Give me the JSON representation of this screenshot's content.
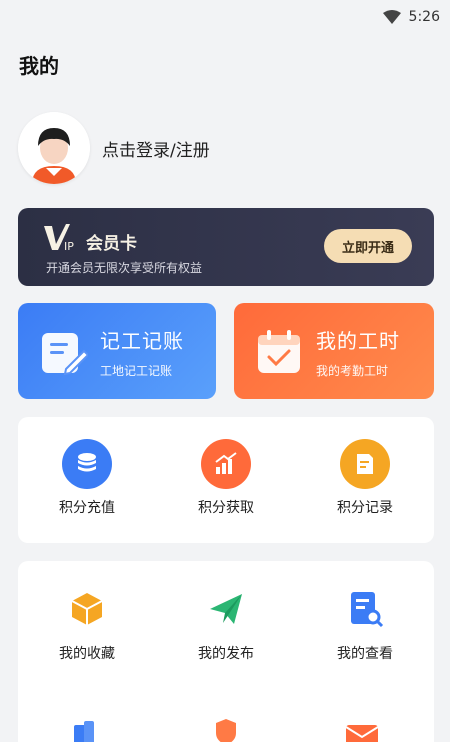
{
  "status": {
    "time": "5:26"
  },
  "header": {
    "title": "我的"
  },
  "profile": {
    "login_text": "点击登录/注册"
  },
  "vip": {
    "title": "会员卡",
    "subtitle": "开通会员无限次享受所有权益",
    "button": "立即开通"
  },
  "cards": [
    {
      "title": "记工记账",
      "subtitle": "工地记工记账",
      "icon": "ledger-icon"
    },
    {
      "title": "我的工时",
      "subtitle": "我的考勤工时",
      "icon": "calendar-check-icon"
    }
  ],
  "points": {
    "items": [
      {
        "label": "积分充值",
        "icon": "coins-icon"
      },
      {
        "label": "积分获取",
        "icon": "chart-up-icon"
      },
      {
        "label": "积分记录",
        "icon": "document-edit-icon"
      }
    ]
  },
  "mine": {
    "items": [
      {
        "label": "我的收藏",
        "icon": "box-icon"
      },
      {
        "label": "我的发布",
        "icon": "paper-plane-icon"
      },
      {
        "label": "我的查看",
        "icon": "doc-search-icon"
      }
    ]
  },
  "colors": {
    "blue": "#3b7cf5",
    "orange": "#ff6a3a",
    "vip_bg": "#2c2f44",
    "vip_btn": "#f5ddb4"
  }
}
